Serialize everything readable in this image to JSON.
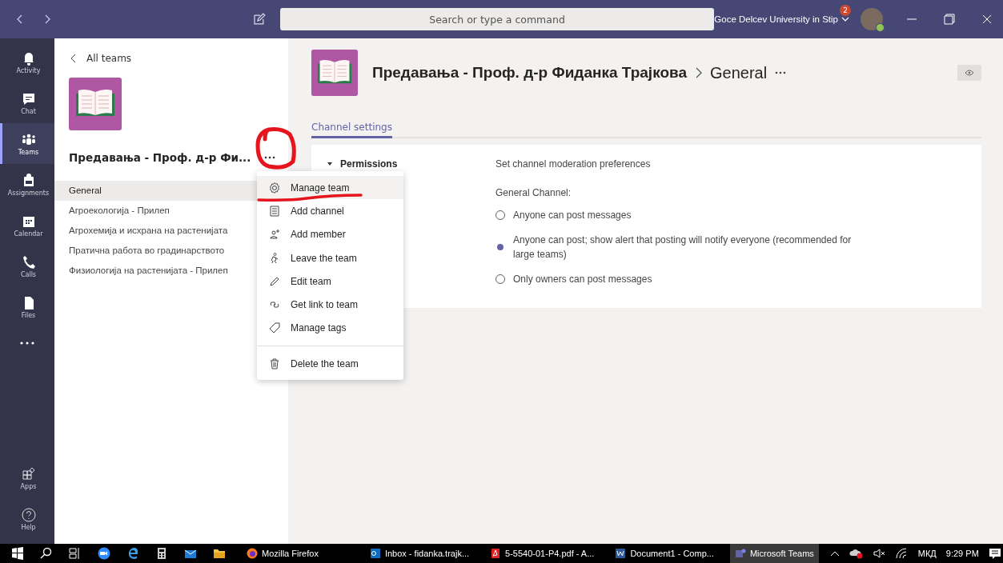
{
  "title_bar": {
    "search": {
      "placeholder": "Search or type a command"
    },
    "organization": "Goce Delcev University in Stip",
    "notification_count": "2"
  },
  "app_bar": {
    "items": [
      {
        "label": "Activity",
        "kind": "bell",
        "selected": false
      },
      {
        "label": "Chat",
        "kind": "chat",
        "selected": false
      },
      {
        "label": "Teams",
        "kind": "teams",
        "selected": true
      },
      {
        "label": "Assignments",
        "kind": "bag",
        "selected": false
      },
      {
        "label": "Calendar",
        "kind": "calendar",
        "selected": false
      },
      {
        "label": "Calls",
        "kind": "phone",
        "selected": false
      },
      {
        "label": "Files",
        "kind": "file",
        "selected": false
      }
    ],
    "bottom_items": [
      {
        "label": "Apps",
        "kind": "apps",
        "selected": false
      },
      {
        "label": "Help",
        "kind": "help",
        "selected": false
      }
    ]
  },
  "team_panel": {
    "back": "All teams",
    "team_name": "Предавања - Проф. д-р Фи...",
    "channels": [
      {
        "name": "General",
        "selected": true
      },
      {
        "name": "Агроекологија - Прилеп",
        "selected": false
      },
      {
        "name": "Агрохемија и исхрана на растенијата",
        "selected": false
      },
      {
        "name": "Пратична работа во градинарството",
        "selected": false
      },
      {
        "name": "Физиологија на растенијата - Прилеп",
        "selected": false
      }
    ]
  },
  "team_menu": {
    "items": [
      {
        "label": "Manage team",
        "kind": "gear",
        "selected": true
      },
      {
        "label": "Add channel",
        "kind": "channel",
        "selected": false
      },
      {
        "label": "Add member",
        "kind": "member",
        "selected": false
      },
      {
        "label": "Leave the team",
        "kind": "leave",
        "selected": false
      },
      {
        "label": "Edit team",
        "kind": "pencil",
        "selected": false
      },
      {
        "label": "Get link to team",
        "kind": "link",
        "selected": false
      },
      {
        "label": "Manage tags",
        "kind": "tag",
        "selected": false
      },
      {
        "label": "Delete the team",
        "kind": "trash",
        "selected": false,
        "separated": true
      }
    ]
  },
  "header": {
    "team_title": "Предавања - Проф. д-р Фиданка Трајкова",
    "channel": "General",
    "tabs": [
      {
        "label": "Channel settings",
        "selected": true
      }
    ]
  },
  "permissions": {
    "label": "Permissions",
    "expanded": true,
    "description": "Set channel moderation preferences",
    "group_label": "General Channel:",
    "options": [
      {
        "label": "Anyone can post messages",
        "selected": false
      },
      {
        "label": "Anyone can post; show alert that posting will notify everyone (recommended for large teams)",
        "selected": true
      },
      {
        "label": "Only owners can post messages",
        "selected": false
      }
    ]
  },
  "taskbar": {
    "apps": [
      {
        "label": "Mozilla Firefox",
        "kind": "firefox",
        "active": false
      },
      {
        "label": "Inbox - fidanka.trajk...",
        "kind": "outlook",
        "active": false
      },
      {
        "label": "5-5540-01-P4.pdf - A...",
        "kind": "pdf",
        "active": false
      },
      {
        "label": "Document1 - Comp...",
        "kind": "word",
        "active": false
      },
      {
        "label": "Microsoft Teams",
        "kind": "teams",
        "active": true
      }
    ],
    "language": "МКД",
    "time": "9:29 PM"
  }
}
